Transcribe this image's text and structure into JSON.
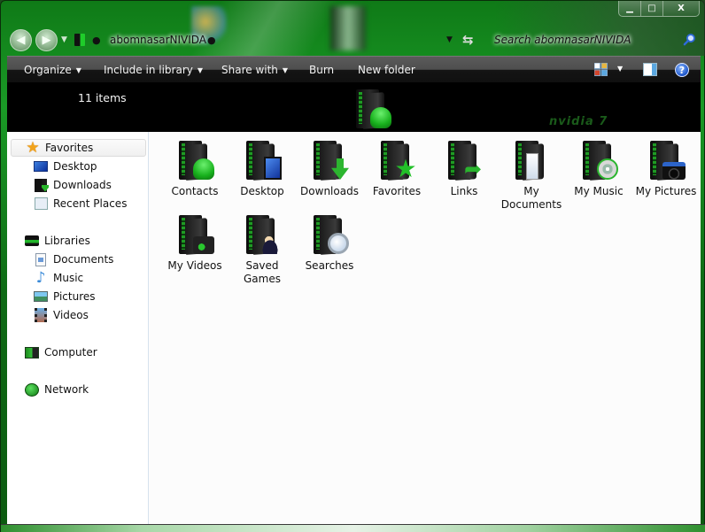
{
  "window": {
    "caption_buttons": {
      "minimize": "▁",
      "maximize": "□",
      "close": "X"
    }
  },
  "address_bar": {
    "back_icon": "arrow-left",
    "forward_icon": "arrow-right",
    "history_caret": "▼",
    "separator": "●",
    "crumb": "abomnasarNIVIDA",
    "dropdown_caret": "▼",
    "refresh_icon": "⇆"
  },
  "search": {
    "placeholder": "Search abomnasarNIVIDA"
  },
  "toolbar": {
    "organize": "Organize",
    "include_in_library": "Include in library",
    "share_with": "Share with",
    "burn": "Burn",
    "new_folder": "New folder",
    "caret": "▼",
    "help": "?"
  },
  "banner": {
    "item_count": "11 items",
    "watermark": "nvidia 7"
  },
  "nav_pane": {
    "favorites": {
      "label": "Favorites",
      "items": [
        {
          "label": "Desktop",
          "icon": "desktop-icon"
        },
        {
          "label": "Downloads",
          "icon": "downloads-icon"
        },
        {
          "label": "Recent Places",
          "icon": "recent-places-icon"
        }
      ]
    },
    "libraries": {
      "label": "Libraries",
      "items": [
        {
          "label": "Documents",
          "icon": "documents-icon"
        },
        {
          "label": "Music",
          "icon": "music-icon"
        },
        {
          "label": "Pictures",
          "icon": "pictures-icon"
        },
        {
          "label": "Videos",
          "icon": "videos-icon"
        }
      ]
    },
    "computer": {
      "label": "Computer"
    },
    "network": {
      "label": "Network"
    }
  },
  "icons": {
    "star": "★",
    "note": "♪",
    "link_arrow": "➦",
    "favorite_star": "★"
  },
  "content": {
    "items": [
      {
        "label": "Contacts",
        "badge": "contacts"
      },
      {
        "label": "Desktop",
        "badge": "desktop"
      },
      {
        "label": "Downloads",
        "badge": "downloads"
      },
      {
        "label": "Favorites",
        "badge": "favorites"
      },
      {
        "label": "Links",
        "badge": "links"
      },
      {
        "label": "My Documents",
        "badge": "mydocs"
      },
      {
        "label": "My Music",
        "badge": "music"
      },
      {
        "label": "My Pictures",
        "badge": "pictures"
      },
      {
        "label": "My Videos",
        "badge": "videos"
      },
      {
        "label": "Saved Games",
        "badge": "games"
      },
      {
        "label": "Searches",
        "badge": "searches"
      }
    ]
  }
}
